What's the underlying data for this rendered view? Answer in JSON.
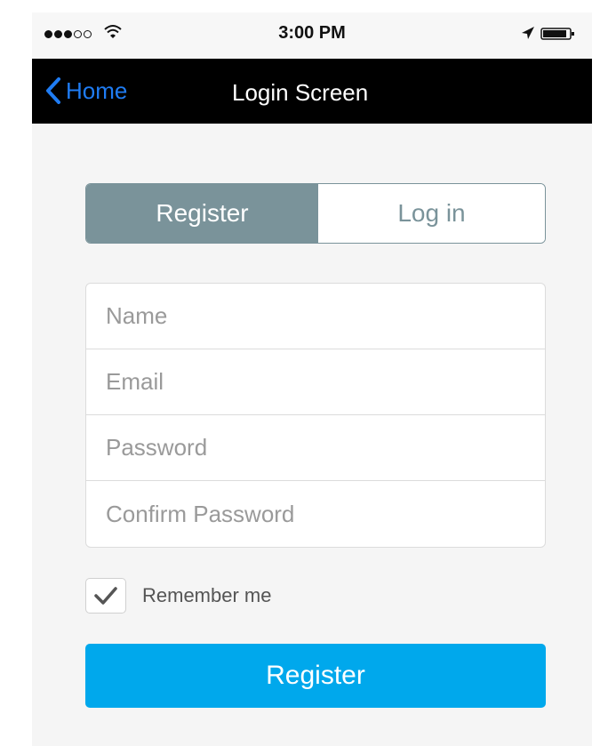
{
  "status_bar": {
    "signal_dots_filled": 3,
    "signal_dots_total": 5,
    "time": "3:00 PM",
    "icons": [
      "signal-icon",
      "wifi-icon",
      "location-arrow-icon",
      "battery-icon"
    ]
  },
  "nav": {
    "back_label": "Home",
    "title": "Login Screen"
  },
  "segmented": {
    "options": [
      "Register",
      "Log in"
    ],
    "selected": "Register"
  },
  "form": {
    "fields": [
      {
        "placeholder": "Name",
        "value": ""
      },
      {
        "placeholder": "Email",
        "value": ""
      },
      {
        "placeholder": "Password",
        "value": ""
      },
      {
        "placeholder": "Confirm Password",
        "value": ""
      }
    ]
  },
  "remember": {
    "label": "Remember me",
    "checked": true
  },
  "submit": {
    "label": "Register"
  },
  "colors": {
    "segment_active": "#7a939a",
    "submit_button": "#00a8ec",
    "nav_link": "#1f7cf3",
    "nav_bar": "#000000"
  }
}
